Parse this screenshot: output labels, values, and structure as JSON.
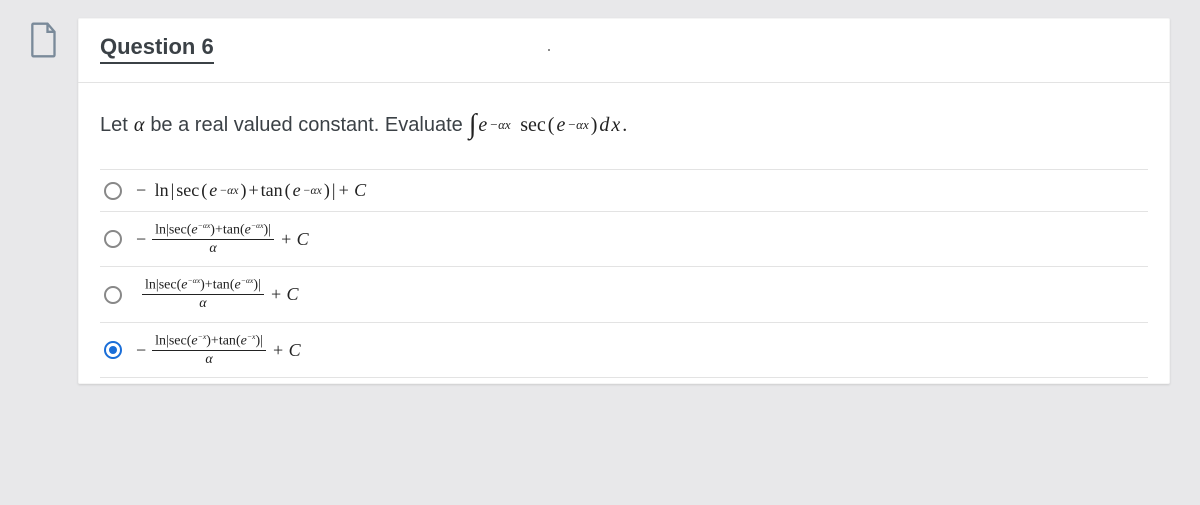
{
  "question": {
    "number_label": "Question 6",
    "prompt_lead": "Let ",
    "prompt_var": "α",
    "prompt_mid": " be a real valued constant.  Evaluate ",
    "integral_sym": "∫",
    "integrand_e": "e",
    "integrand_exp": "−αx",
    "sec": "sec",
    "open": "(",
    "close": ")",
    "dx_d": "d",
    "dx_x": "x",
    "period": " ."
  },
  "options": [
    {
      "selected": false,
      "lead": "−",
      "ln": "ln",
      "pipe_open": "|",
      "sec": "sec",
      "open": "(",
      "e": "e",
      "exp1": "−αx",
      "close": ")",
      "plus": " + ",
      "tan": "tan",
      "exp2": "−αx",
      "pipe_close": "|",
      "tail": " + C"
    },
    {
      "selected": false,
      "lead": "−",
      "num_ln": "ln",
      "pipe_open": "|",
      "sec": "sec",
      "open": "(",
      "e": "e",
      "exp1": "−αx",
      "close": ")",
      "plus": "+",
      "tan": "tan",
      "exp2": "−αx",
      "pipe_close": "|",
      "den": "α",
      "tail": " + C"
    },
    {
      "selected": false,
      "lead": "",
      "num_ln": "ln",
      "pipe_open": "|",
      "sec": "sec",
      "open": "(",
      "e": "e",
      "exp1": "−αx",
      "close": ")",
      "plus": "+",
      "tan": "tan",
      "exp2": "−αx",
      "pipe_close": "|",
      "den": "α",
      "tail": " + C"
    },
    {
      "selected": true,
      "lead": "−",
      "num_ln": "ln",
      "pipe_open": "|",
      "sec": "sec",
      "open": "(",
      "e": "e",
      "exp1": "−x",
      "close": ")",
      "plus": "+",
      "tan": "tan",
      "exp2": "−x",
      "pipe_close": "|",
      "den": "α",
      "tail": " + C"
    }
  ]
}
